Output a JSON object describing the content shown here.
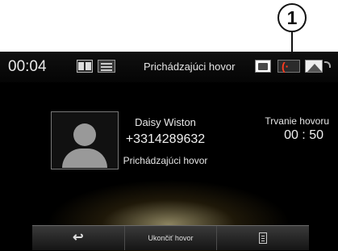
{
  "callout": {
    "label": "1"
  },
  "status_bar": {
    "time": "00:04",
    "title": "Prichádzajúci hovor",
    "phone_glyph": "(·"
  },
  "caller": {
    "name": "Daisy Wiston",
    "number": "+3314289632",
    "status": "Prichádzajúci hovor"
  },
  "duration": {
    "label": "Trvanie hovoru",
    "value": "00 : 50"
  },
  "bottom_bar": {
    "back_glyph": "↩",
    "end_call_label": "Ukončiť hovor"
  },
  "colors": {
    "phone_accent": "#ff3b1f",
    "background": "#000000"
  },
  "icons": [
    "book-icon",
    "list-icon",
    "sms-icon",
    "phone-icon",
    "navigation-icon",
    "back-icon",
    "menu-icon"
  ]
}
